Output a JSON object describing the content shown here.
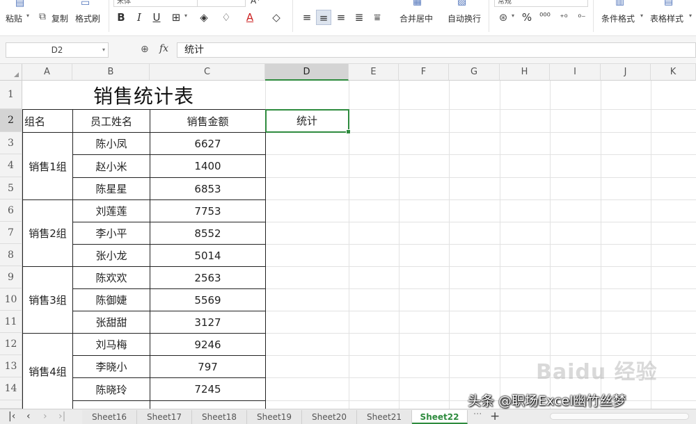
{
  "ribbon": {
    "paste": "粘贴",
    "copy": "复制",
    "format_painter": "格式刷",
    "bold": "B",
    "italic": "I",
    "underline": "U",
    "merge_center": "合并居中",
    "wrap_text": "自动换行",
    "percent": "%",
    "cond_format": "条件格式",
    "table_style": "表格样式",
    "num_format": "常规",
    "font_name": "宋体"
  },
  "formula_bar": {
    "cell_ref": "D2",
    "fx": "fx",
    "content": "统计"
  },
  "columns": [
    "A",
    "B",
    "C",
    "D",
    "E",
    "F",
    "G",
    "H",
    "I",
    "J",
    "K"
  ],
  "rows": [
    "1",
    "2",
    "3",
    "4",
    "5",
    "6",
    "7",
    "8",
    "9",
    "10",
    "11",
    "12",
    "13",
    "14"
  ],
  "sheet": {
    "title": "销售统计表",
    "headers": [
      "组名",
      "员工姓名",
      "销售金额",
      "统计"
    ],
    "groups": [
      "销售1组",
      "销售2组",
      "销售3组",
      "销售4组"
    ],
    "records": [
      {
        "name": "陈小凤",
        "amount": "6627"
      },
      {
        "name": "赵小米",
        "amount": "1400"
      },
      {
        "name": "陈星星",
        "amount": "6853"
      },
      {
        "name": "刘莲莲",
        "amount": "7753"
      },
      {
        "name": "李小平",
        "amount": "8552"
      },
      {
        "name": "张小龙",
        "amount": "5014"
      },
      {
        "name": "陈欢欢",
        "amount": "2563"
      },
      {
        "name": "陈御婕",
        "amount": "5569"
      },
      {
        "name": "张甜甜",
        "amount": "3127"
      },
      {
        "name": "刘马梅",
        "amount": "9246"
      },
      {
        "name": "李晓小",
        "amount": "797"
      },
      {
        "name": "陈晓玲",
        "amount": "7245"
      }
    ]
  },
  "tabs": [
    "Sheet16",
    "Sheet17",
    "Sheet18",
    "Sheet19",
    "Sheet20",
    "Sheet21",
    "Sheet22"
  ],
  "active_tab": "Sheet22",
  "watermark": "头条 @职场Excel幽竹丝梦",
  "baidu_mark": "Baidu 经验",
  "colors": {
    "accent": "#2e8b3e",
    "ribbon_icon": "#4a6fb8"
  }
}
